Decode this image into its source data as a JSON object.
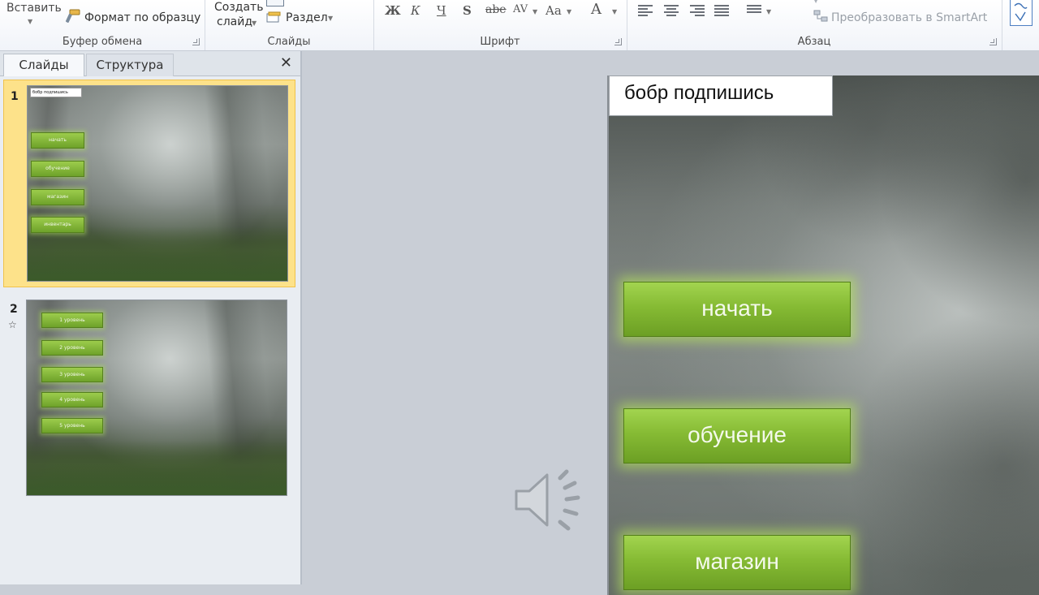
{
  "ribbon": {
    "clipboard": {
      "paste_label": "Вставить",
      "format_painter_label": "Формат по образцу",
      "group_label": "Буфер обмена"
    },
    "slides": {
      "new_slide_label_line1": "Создать",
      "new_slide_label_line2": "слайд",
      "section_label": "Раздел",
      "group_label": "Слайды"
    },
    "font": {
      "bold": "Ж",
      "italic": "К",
      "underline": "Ч",
      "shadow": "S",
      "strikethrough": "abe",
      "spacing": "AV",
      "case": "Aa",
      "color": "A",
      "group_label": "Шрифт"
    },
    "paragraph": {
      "smartart_label": "Преобразовать в SmartArt",
      "group_label": "Абзац"
    }
  },
  "panel": {
    "tabs": [
      "Слайды",
      "Структура"
    ],
    "close_glyph": "✕",
    "thumbnails": [
      {
        "number": "1",
        "title": "бобр подпишись",
        "buttons": [
          "начать",
          "обучение",
          "магазин",
          "инвентарь"
        ]
      },
      {
        "number": "2",
        "buttons": [
          "1 уровень",
          "2 уровень",
          "3 уровень",
          "4 уровень",
          "5 уровень"
        ]
      }
    ]
  },
  "slide": {
    "title": "бобр подпишись",
    "buttons": [
      "начать",
      "обучение",
      "магазин"
    ]
  },
  "colors": {
    "button_green": "#86bb34",
    "selection": "#fde28a",
    "workspace": "#c9ced6"
  },
  "icons": [
    "format-painter-icon",
    "section-icon",
    "close-icon",
    "animation-star-icon",
    "speaker-icon"
  ]
}
